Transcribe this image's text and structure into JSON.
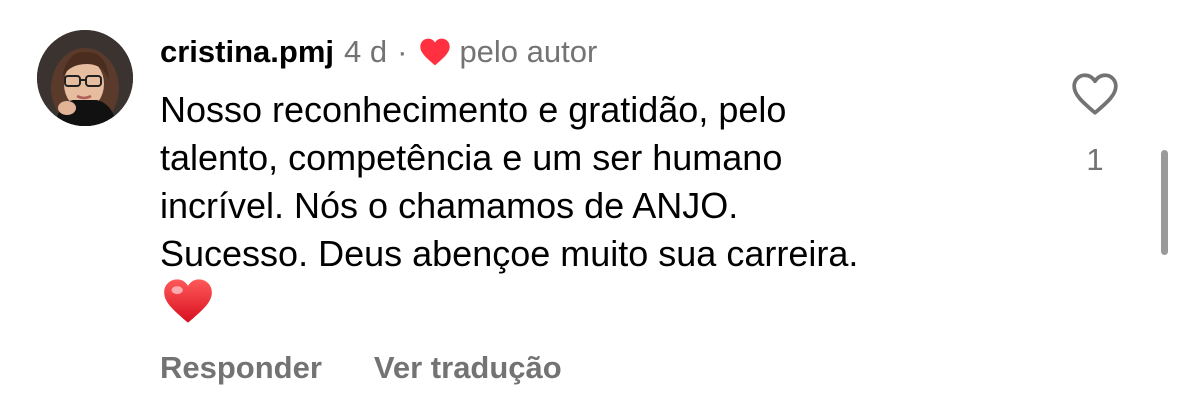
{
  "comment": {
    "username": "cristina.pmj",
    "time_ago": "4 d",
    "separator": "·",
    "author_liked_label": "pelo autor",
    "text_lines": [
      "Nosso reconhecimento e gratidão, pelo",
      "talento, competência e um ser humano",
      "incrível. Nós o chamamos de ANJO.",
      "Sucesso. Deus abençoe muito sua carreira."
    ],
    "emoji": "red-heart-emoji",
    "like_count": "1"
  },
  "actions": {
    "reply_label": "Responder",
    "translate_label": "Ver tradução"
  },
  "icons": {
    "author_heart": "heart-filled-icon",
    "like": "heart-outline-icon"
  },
  "colors": {
    "heart_red": "#ff3040",
    "meta_gray": "#737373",
    "text": "#000000"
  }
}
